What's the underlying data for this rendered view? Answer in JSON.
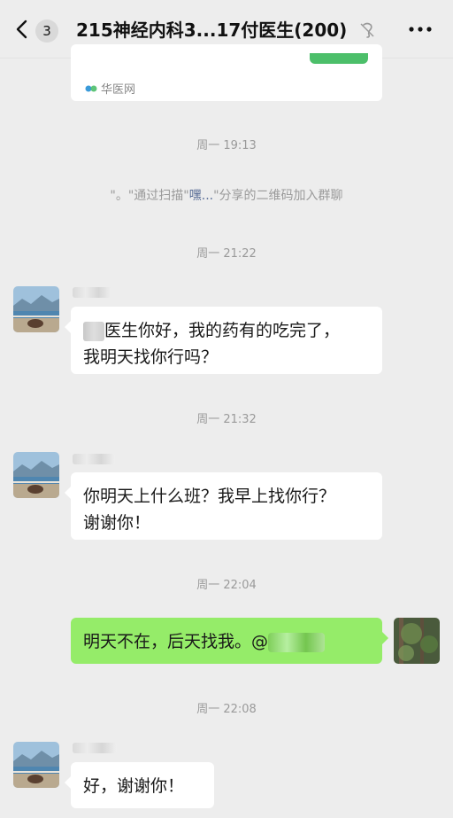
{
  "header": {
    "unread_count": "3",
    "title": "215神经内科3...17付医生(200)"
  },
  "link_card": {
    "source": "华医网"
  },
  "messages": {
    "t1": "周一 19:13",
    "system_prefix": "\"。\"通过扫描\"",
    "system_name": "嘿...",
    "system_suffix": "\"分享的二维码加入群聊",
    "t2": "周一 21:22",
    "m1_line1": "医生你好，我的药有的吃完了，",
    "m1_line2": "我明天找你行吗？",
    "t3": "周一 21:32",
    "m2_line1": "你明天上什么班？我早上找你行？",
    "m2_line2": "谢谢你！",
    "t4": "周一 22:04",
    "m3": "明天不在，后天找我。@",
    "t5": "周一 22:08",
    "m4": "好，谢谢你！"
  },
  "colors": {
    "background": "#ededed",
    "bubble_incoming": "#ffffff",
    "bubble_outgoing": "#95ec69",
    "link": "#576b95"
  },
  "icons": [
    "back-arrow-icon",
    "mute-icon",
    "more-icon",
    "source-logo-icon"
  ]
}
